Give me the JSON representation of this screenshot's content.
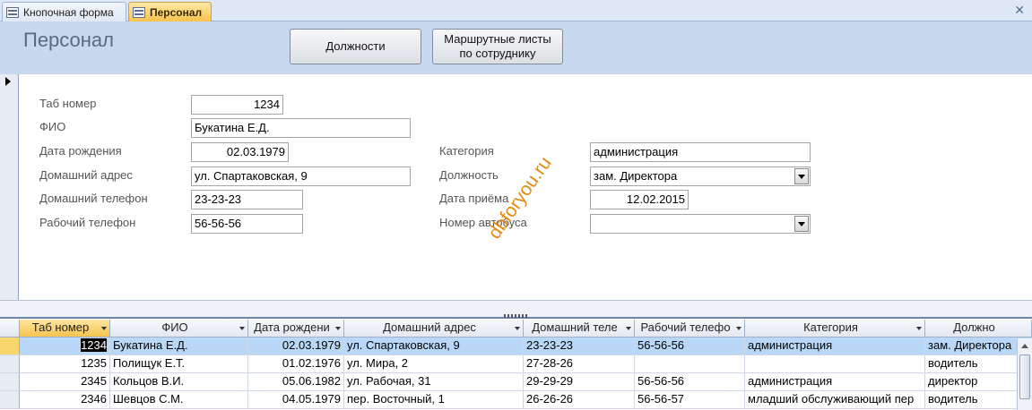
{
  "tabs": [
    {
      "label": "Кнопочная форма",
      "active": false
    },
    {
      "label": "Персонал",
      "active": true
    }
  ],
  "form": {
    "title": "Персонал",
    "buttons": {
      "positions": "Должности",
      "routes_line1": "Маршрутные листы",
      "routes_line2": "по сотруднику"
    },
    "fields": {
      "tab_num": {
        "label": "Таб номер",
        "value": "1234"
      },
      "fio": {
        "label": "ФИО",
        "value": "Букатина Е.Д."
      },
      "birth": {
        "label": "Дата рождения",
        "value": "02.03.1979"
      },
      "address": {
        "label": "Домашний адрес",
        "value": "ул. Спартаковская, 9"
      },
      "home_phone": {
        "label": "Домашний телефон",
        "value": "23-23-23"
      },
      "work_phone": {
        "label": "Рабочий телефон",
        "value": "56-56-56"
      },
      "category": {
        "label": "Категория",
        "value": "администрация"
      },
      "position": {
        "label": "Должность",
        "value": "зам. Директора"
      },
      "hire_date": {
        "label": "Дата приёма",
        "value": "12.02.2015"
      },
      "bus_num": {
        "label": "Номер автобуса",
        "value": ""
      }
    },
    "watermark": "dbforyou.ru"
  },
  "datasheet": {
    "columns": [
      "Таб номер",
      "ФИО",
      "Дата рождени",
      "Домашний адрес",
      "Домашний теле",
      "Рабочий телефо",
      "Категория",
      "Должно"
    ],
    "rows": [
      [
        "1234",
        "Букатина Е.Д.",
        "02.03.1979",
        "ул. Спартаковская, 9",
        "23-23-23",
        "56-56-56",
        "администрация",
        "зам. Директора"
      ],
      [
        "1235",
        "Полищук Е.Т.",
        "01.02.1976",
        "ул. Мира, 2",
        "27-28-26",
        "",
        "",
        "водитель"
      ],
      [
        "2345",
        "Кольцов В.И.",
        "05.06.1982",
        "ул. Рабочая, 31",
        "29-29-29",
        "56-56-56",
        "администрация",
        "директор"
      ],
      [
        "2346",
        "Шевцов С.М.",
        "04.05.1979",
        "пер. Восточный, 1",
        "26-26-26",
        "56-56-57",
        "младший обслуживающий пер",
        "водитель"
      ]
    ]
  },
  "colors": {
    "header_band": "#c7d8ef",
    "active_tab": "#f8c24e",
    "selected_row": "#b9d8f7"
  }
}
